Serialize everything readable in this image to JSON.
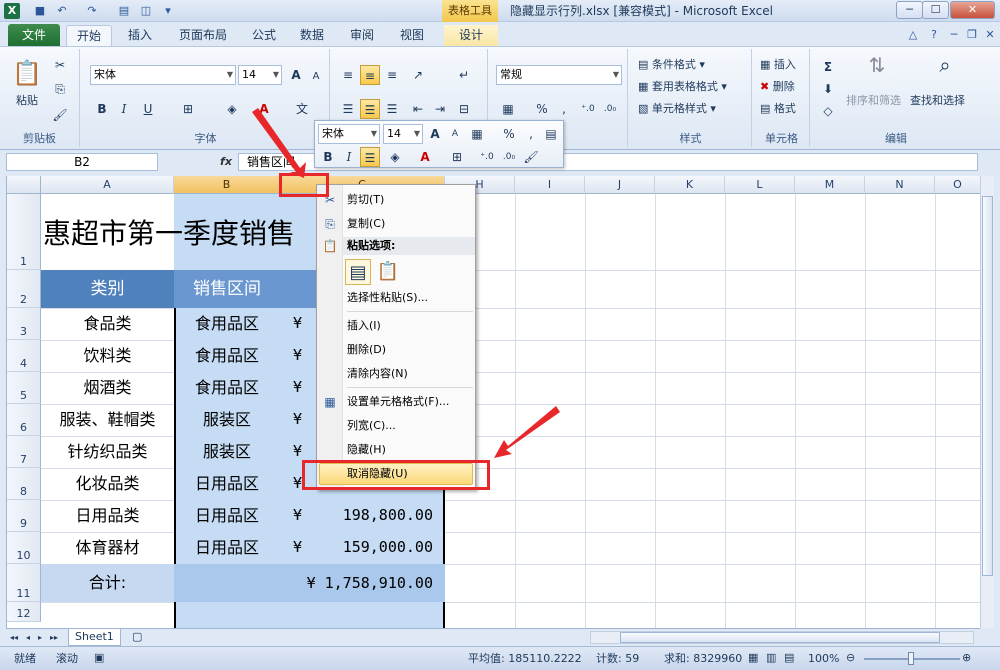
{
  "titlebar": {
    "app_letter": "X",
    "table_tools": "表格工具",
    "window_title": "隐藏显示行列.xlsx  [兼容模式]  -  Microsoft Excel",
    "buttons": [
      "─",
      "☐",
      "✕"
    ]
  },
  "tabs": {
    "file": "文件",
    "items": [
      "开始",
      "插入",
      "页面布局",
      "公式",
      "数据",
      "审阅",
      "视图",
      "设计"
    ]
  },
  "ribbon": {
    "clipboard": {
      "label": "剪贴板",
      "paste": "粘贴"
    },
    "font": {
      "label": "字体",
      "name": "宋体",
      "size": "14",
      "bold": "B",
      "italic": "I",
      "underline": "U",
      "grow": "A",
      "shrink": "A"
    },
    "alignment": {
      "label": ""
    },
    "number": {
      "label": "",
      "format": "常规",
      "percent": "%",
      "comma": ","
    },
    "styles": {
      "label": "样式",
      "items": [
        "条件格式",
        "套用表格格式",
        "单元格样式"
      ]
    },
    "cells": {
      "label": "单元格",
      "items": [
        "插入",
        "删除",
        "格式"
      ]
    },
    "editing": {
      "label": "编辑",
      "sigma": "Σ",
      "sort": "排序和筛选",
      "find": "查找和选择"
    }
  },
  "formula_bar": {
    "name_box": "B2",
    "fx": "fx",
    "content": "销售区间"
  },
  "columns": [
    "A",
    "B",
    "C",
    "H",
    "I",
    "J",
    "K",
    "L",
    "M",
    "N",
    "O"
  ],
  "rows": [
    "1",
    "2",
    "3",
    "4",
    "5",
    "6",
    "7",
    "8",
    "9",
    "10",
    "11",
    "12"
  ],
  "sheet": {
    "title": "惠超市第一季度销售",
    "headers": [
      "类别",
      "销售区间"
    ],
    "data": [
      {
        "cat": "食品类",
        "area": "食用品区",
        "yen": "¥",
        "amt": ""
      },
      {
        "cat": "饮料类",
        "area": "食用品区",
        "yen": "¥",
        "amt": ""
      },
      {
        "cat": "烟酒类",
        "area": "食用品区",
        "yen": "¥",
        "amt": ""
      },
      {
        "cat": "服装、鞋帽类",
        "area": "服装区",
        "yen": "¥",
        "amt": ""
      },
      {
        "cat": "针纺织品类",
        "area": "服装区",
        "yen": "¥",
        "amt": ""
      },
      {
        "cat": "化妆品类",
        "area": "日用品区",
        "yen": "¥",
        "amt": ""
      },
      {
        "cat": "日用品类",
        "area": "日用品区",
        "yen": "¥",
        "amt": "198,800.00"
      },
      {
        "cat": "体育器材",
        "area": "日用品区",
        "yen": "¥",
        "amt": "159,000.00"
      }
    ],
    "total_label": "合计:",
    "total_value": "¥ 1,758,910.00"
  },
  "mini_toolbar": {
    "font": "宋体",
    "size": "14",
    "bold": "B",
    "italic": "I",
    "percent": "%",
    "comma": ","
  },
  "context_menu": {
    "items": [
      "剪切(T)",
      "复制(C)",
      "粘贴选项:",
      "选择性粘贴(S)...",
      "插入(I)",
      "删除(D)",
      "清除内容(N)",
      "设置单元格格式(F)...",
      "列宽(C)...",
      "隐藏(H)",
      "取消隐藏(U)"
    ]
  },
  "sheet_tabs": {
    "nav": [
      "◂◂",
      "◂",
      "▸",
      "▸▸"
    ],
    "active": "Sheet1"
  },
  "statusbar": {
    "mode": "就绪",
    "scroll": "滚动",
    "average": "平均值: 185110.2222",
    "count": "计数: 59",
    "sum": "求和: 8329960",
    "zoom": "100%"
  },
  "colors": {
    "header_blue": "#4f81bd",
    "selection": "#c5dcf4",
    "accent": "#e8272a"
  }
}
